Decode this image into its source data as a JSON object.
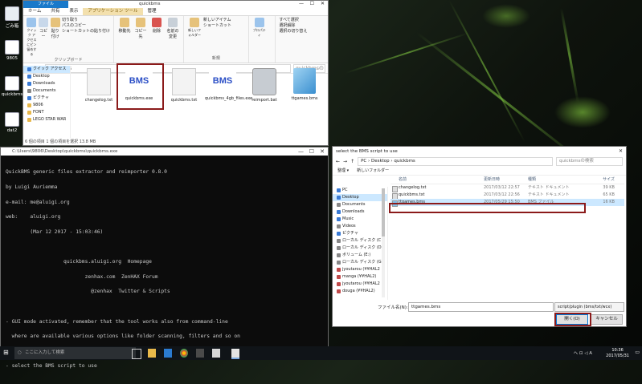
{
  "desktop": {
    "icons": [
      {
        "label": "ごみ箱"
      },
      {
        "label": "9805"
      },
      {
        "label": "quickbms"
      },
      {
        "label": "dat2"
      }
    ]
  },
  "explorer": {
    "title": "quickbms",
    "tabs": [
      "ファイル",
      "ホーム",
      "共有",
      "表示",
      "アプリケーション ツール",
      "管理"
    ],
    "ribbon": {
      "pin": "クイック アクセスにピン留めする",
      "copy": "コピー",
      "paste": "貼り付け",
      "cut": "切り取り",
      "copy_path": "パスのコピー",
      "paste_shortcut": "ショートカットの貼り付け",
      "clipboard": "クリップボード",
      "move_to": "移動先",
      "copy_to": "コピー先",
      "delete": "削除",
      "rename": "名前の変更",
      "new_folder": "新しいフォルダー",
      "new_item": "新しいアイテム",
      "shortcut": "ショートカット",
      "new": "新規",
      "properties": "プロパティ",
      "select_all": "すべて選択",
      "select_none": "選択解除",
      "invert": "選択の切り替え"
    },
    "address": "quickbms",
    "search_placeholder": "quickbmsの検索",
    "nav": [
      {
        "label": "クイック アクセス",
        "color": "#3a7bd5"
      },
      {
        "label": "Desktop",
        "color": "#3a7bd5"
      },
      {
        "label": "Downloads",
        "color": "#3a7bd5"
      },
      {
        "label": "Documents",
        "color": "#888888"
      },
      {
        "label": "ピクチャ",
        "color": "#3a7bd5"
      },
      {
        "label": "9806",
        "color": "#e8b84a"
      },
      {
        "label": "FONT",
        "color": "#e8b84a"
      },
      {
        "label": "LEGO STAR WAR",
        "color": "#e8b84a"
      }
    ],
    "files": [
      {
        "name": "changelog.txt",
        "kind": "txt"
      },
      {
        "name": "quickbms.exe",
        "kind": "bms"
      },
      {
        "name": "quickbms.txt",
        "kind": "txt"
      },
      {
        "name": "quickbms_4gb_files.exe",
        "kind": "bms"
      },
      {
        "name": "reimport.bat",
        "kind": "bat"
      },
      {
        "name": "ttgames.bms",
        "kind": "note"
      }
    ],
    "status": "6 個の項目 1 個の項目を選択 13.8 MB"
  },
  "console": {
    "title": "C:\\Users\\9806\\Desktop\\quickbms\\quickbms.exe",
    "lines": [
      "QuickBMS generic files extractor and reimporter 0.8.0",
      "by Luigi Auriemma",
      "e-mail: me@aluigi.org",
      "web:    aluigi.org",
      "        (Mar 12 2017 - 15:03:46)",
      "",
      "                   quickbms.aluigi.org  Homepage",
      "                          zenhax.com  ZenHAX Forum",
      "                            @zenhax  Twitter & Scripts",
      "",
      "- GUI mode activated, remember that the tool works also from command-line",
      "  where are available various options like folder scanning, filters and so on",
      "",
      "- select the BMS script to use"
    ]
  },
  "dialog": {
    "title": "select the BMS script to use",
    "breadcrumb": [
      "PC",
      "Desktop",
      "quickbms"
    ],
    "search_placeholder": "quickbmsの検索",
    "organize": "整理 ▾",
    "new_folder": "新しいフォルダー",
    "nav": [
      {
        "label": "PC",
        "color": "#3a7bd5"
      },
      {
        "label": "Desktop",
        "color": "#3a7bd5"
      },
      {
        "label": "Documents",
        "color": "#888888"
      },
      {
        "label": "Downloads",
        "color": "#3a7bd5"
      },
      {
        "label": "Music",
        "color": "#3a7bd5"
      },
      {
        "label": "Videos",
        "color": "#888888"
      },
      {
        "label": "ピクチャ",
        "color": "#3a7bd5"
      },
      {
        "label": "ローカル ディスク (C",
        "color": "#888888"
      },
      {
        "label": "ローカル ディスク (D",
        "color": "#888888"
      },
      {
        "label": "ボリューム (E:)",
        "color": "#888888"
      },
      {
        "label": "ローカル ディスク (G",
        "color": "#888888"
      },
      {
        "label": "jyoutarou (¥¥HAL2",
        "color": "#c04a4a"
      },
      {
        "label": "manga (¥¥HAL2)",
        "color": "#c04a4a"
      },
      {
        "label": "jyoutarou (¥¥HAL2",
        "color": "#c04a4a"
      },
      {
        "label": "douga (¥¥HAL2)",
        "color": "#c04a4a"
      }
    ],
    "columns": [
      "名前",
      "更新日時",
      "種類",
      "サイズ"
    ],
    "rows": [
      {
        "name": "changelog.txt",
        "date": "2017/03/12 22:57",
        "type": "テキスト ドキュメント",
        "size": "39 KB"
      },
      {
        "name": "quickbms.txt",
        "date": "2017/03/12 22:56",
        "type": "テキスト ドキュメント",
        "size": "65 KB"
      },
      {
        "name": "ttgames.bms",
        "date": "2017/05/29 15:50",
        "type": "BMS ファイル",
        "size": "16 KB"
      }
    ],
    "filename_label": "ファイル名(N):",
    "filename_value": "ttgames.bms",
    "filter": "script/plugin (bms/txt/wcx)",
    "open": "開く(O)",
    "cancel": "キャンセル"
  },
  "taskbar": {
    "search_placeholder": "ここに入力して検索",
    "tray": "へ ⊡ ◁ A",
    "time": "10:36",
    "date": "2017/05/31"
  }
}
